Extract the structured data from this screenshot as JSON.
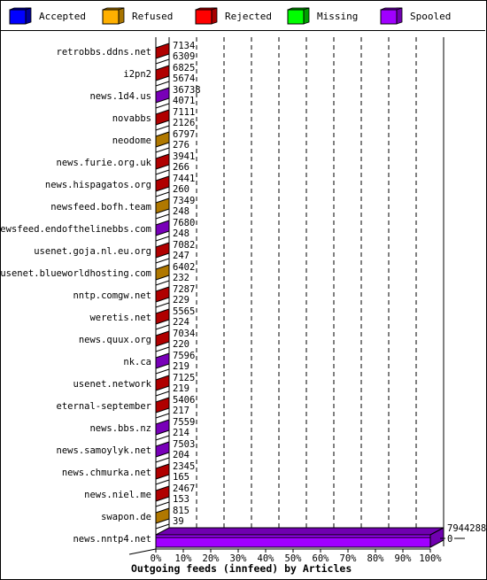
{
  "legend": [
    {
      "label": "Accepted",
      "color": "#0000ff",
      "side": "#00009b",
      "icon": "blue-cube-icon"
    },
    {
      "label": "Refused",
      "color": "#ffb000",
      "side": "#a87400",
      "icon": "orange-cube-icon"
    },
    {
      "label": "Rejected",
      "color": "#ff0000",
      "side": "#a80000",
      "icon": "red-cube-icon"
    },
    {
      "label": "Missing",
      "color": "#00ff00",
      "side": "#00a000",
      "icon": "green-cube-icon"
    },
    {
      "label": "Spooled",
      "color": "#a000ff",
      "side": "#7000b0",
      "icon": "purple-cube-icon"
    }
  ],
  "chart_data": {
    "type": "bar",
    "orientation": "horizontal",
    "stacked": true,
    "title": "Outgoing feeds (innfeed) by Articles",
    "xlabel": "Outgoing feeds (innfeed) by Articles",
    "ylabel": "",
    "xlim": [
      0,
      100
    ],
    "x_unit": "%",
    "x_ticks": [
      "0%",
      "10%",
      "20%",
      "30%",
      "40%",
      "50%",
      "60%",
      "70%",
      "80%",
      "90%",
      "100%"
    ],
    "grid": true,
    "legend_position": "top",
    "series_names": [
      "Accepted",
      "Refused",
      "Rejected",
      "Missing",
      "Spooled"
    ],
    "categories": [
      "retrobbs.ddns.net",
      "i2pn2",
      "news.1d4.us",
      "novabbs",
      "neodome",
      "news.furie.org.uk",
      "news.hispagatos.org",
      "newsfeed.bofh.team",
      "newsfeed.endofthelinebbs.com",
      "usenet.goja.nl.eu.org",
      "usenet.blueworldhosting.com",
      "nntp.comgw.net",
      "weretis.net",
      "news.quux.org",
      "nk.ca",
      "usenet.network",
      "eternal-september",
      "news.bbs.nz",
      "news.samoylyk.net",
      "news.chmurka.net",
      "news.niel.me",
      "swapon.de",
      "news.nntp4.net"
    ],
    "rows": [
      {
        "name": "retrobbs.ddns.net",
        "total": 7134,
        "accepted": 6309,
        "dominant": "Rejected"
      },
      {
        "name": "i2pn2",
        "total": 6825,
        "accepted": 5674,
        "dominant": "Rejected"
      },
      {
        "name": "news.1d4.us",
        "total": 36738,
        "accepted": 4071,
        "dominant": "Spooled"
      },
      {
        "name": "novabbs",
        "total": 7111,
        "accepted": 2126,
        "dominant": "Rejected"
      },
      {
        "name": "neodome",
        "total": 6797,
        "accepted": 276,
        "dominant": "Refused"
      },
      {
        "name": "news.furie.org.uk",
        "total": 3941,
        "accepted": 266,
        "dominant": "Rejected"
      },
      {
        "name": "news.hispagatos.org",
        "total": 7441,
        "accepted": 260,
        "dominant": "Rejected"
      },
      {
        "name": "newsfeed.bofh.team",
        "total": 7349,
        "accepted": 248,
        "dominant": "Refused"
      },
      {
        "name": "newsfeed.endofthelinebbs.com",
        "total": 7680,
        "accepted": 248,
        "dominant": "Spooled"
      },
      {
        "name": "usenet.goja.nl.eu.org",
        "total": 7082,
        "accepted": 247,
        "dominant": "Rejected"
      },
      {
        "name": "usenet.blueworldhosting.com",
        "total": 6402,
        "accepted": 232,
        "dominant": "Refused"
      },
      {
        "name": "nntp.comgw.net",
        "total": 7287,
        "accepted": 229,
        "dominant": "Rejected"
      },
      {
        "name": "weretis.net",
        "total": 5565,
        "accepted": 224,
        "dominant": "Rejected"
      },
      {
        "name": "news.quux.org",
        "total": 7034,
        "accepted": 220,
        "dominant": "Rejected"
      },
      {
        "name": "nk.ca",
        "total": 7596,
        "accepted": 219,
        "dominant": "Spooled"
      },
      {
        "name": "usenet.network",
        "total": 7125,
        "accepted": 219,
        "dominant": "Rejected"
      },
      {
        "name": "eternal-september",
        "total": 5406,
        "accepted": 217,
        "dominant": "Rejected"
      },
      {
        "name": "news.bbs.nz",
        "total": 7559,
        "accepted": 214,
        "dominant": "Spooled"
      },
      {
        "name": "news.samoylyk.net",
        "total": 7503,
        "accepted": 204,
        "dominant": "Spooled"
      },
      {
        "name": "news.chmurka.net",
        "total": 2345,
        "accepted": 165,
        "dominant": "Rejected"
      },
      {
        "name": "news.niel.me",
        "total": 2467,
        "accepted": 153,
        "dominant": "Rejected"
      },
      {
        "name": "swapon.de",
        "total": 815,
        "accepted": 39,
        "dominant": "Refused"
      },
      {
        "name": "news.nntp4.net",
        "total": 7944288,
        "accepted": 0,
        "dominant": "Spooled"
      }
    ]
  }
}
